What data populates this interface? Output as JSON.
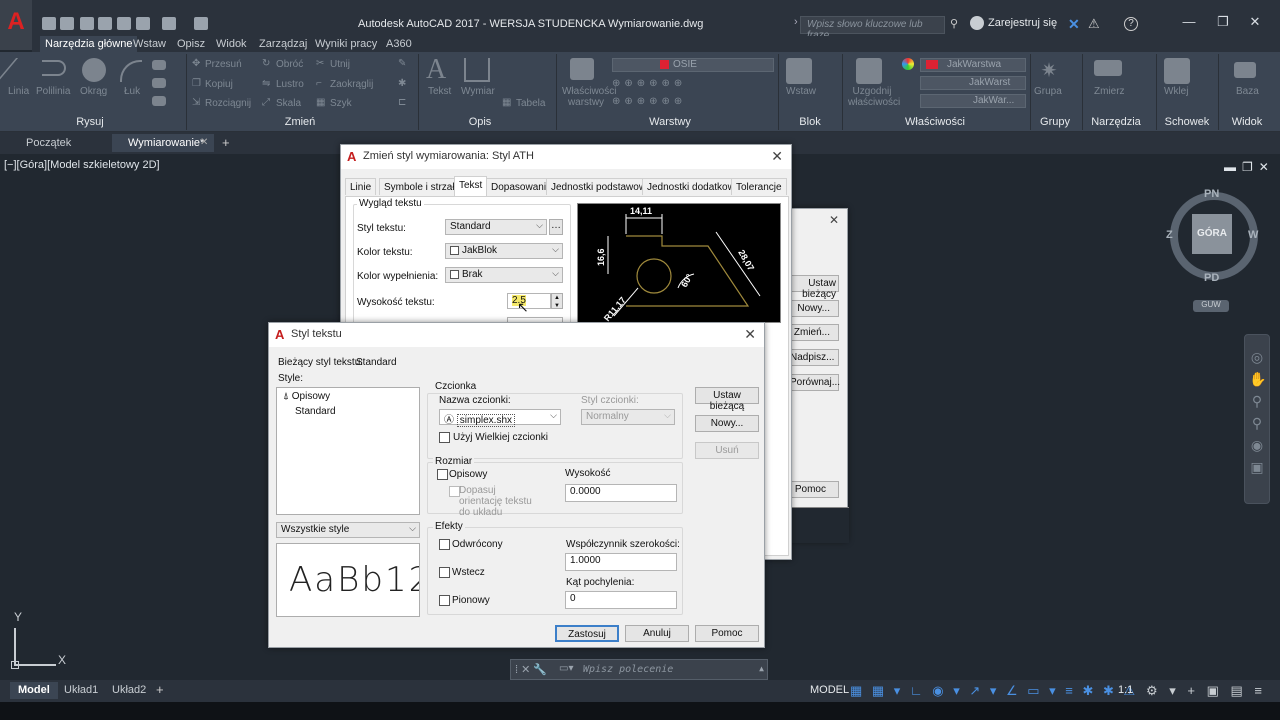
{
  "app": {
    "title": "Autodesk AutoCAD 2017 - WERSJA STUDENCKA    Wymiarowanie.dwg",
    "search_placeholder": "Wpisz słowo kluczowe lub frazę",
    "signin": "Zarejestruj się",
    "help": "?",
    "logo": "A"
  },
  "ribbon_tabs": [
    "Narzędzia główne",
    "Wstaw",
    "Opisz",
    "Widok",
    "Zarządzaj",
    "Wyniki pracy",
    "A360"
  ],
  "ribbon_panels": [
    "Rysuj",
    "Zmień",
    "Opis",
    "Warstwy",
    "Blok",
    "Właściwości",
    "Grupy",
    "Narzędzia",
    "Schowek",
    "Widok"
  ],
  "ribbon_labels": {
    "linia": "Linia",
    "polilinia": "Polilinia",
    "okrag": "Okrąg",
    "luk": "Łuk",
    "przesun": "Przesuń",
    "kopiuj": "Kopiuj",
    "rozciagnij": "Rozciągnij",
    "obroc": "Obróć",
    "lustro": "Lustro",
    "skala": "Skala",
    "utnij": "Utnij",
    "zaokraglij": "Zaokrąglij",
    "szyk": "Szyk",
    "tekst": "Tekst",
    "wymiar": "Wymiar",
    "tabela": "Tabela",
    "wlasciwosci_warstwy": "Właściwości warstwy",
    "layer_name": "OSIE",
    "wstaw": "Wstaw",
    "uzgodnij": "Uzgodnij właściwości",
    "jakwarstwa": "JakWarstwa",
    "jakwarst": "JakWarst",
    "jakwar": "JakWar...",
    "grupa": "Grupa",
    "zmierz": "Zmierz",
    "wklej": "Wklej",
    "baza": "Baza"
  },
  "doc_tabs": [
    "Początek",
    "Wymiarowanie*"
  ],
  "view_label": "[−][Góra][Model szkieletowy 2D]",
  "viewcube": {
    "top": "GÓRA",
    "n": "PN",
    "s": "PD",
    "e": "W",
    "w": "Z",
    "wcs": "GUW"
  },
  "ucs": {
    "x": "X",
    "y": "Y"
  },
  "command_placeholder": "Wpisz polecenie",
  "layout_tabs": [
    "Model",
    "Układ1",
    "Układ2"
  ],
  "status": {
    "model": "MODEL",
    "scale": "1:1"
  },
  "bg_dialog": {
    "buttons": [
      "Ustaw bieżący",
      "Nowy...",
      "Zmień...",
      "Nadpisz...",
      "Porównaj...",
      "Pomoc"
    ]
  },
  "dim_dialog": {
    "title": "Zmień styl wymiarowania: Styl ATH",
    "tabs": [
      "Linie",
      "Symbole i strzałki",
      "Tekst",
      "Dopasowanie",
      "Jednostki podstawowe",
      "Jednostki dodatkowe",
      "Tolerancje"
    ],
    "group": "Wygląd tekstu",
    "rows": [
      {
        "label": "Styl tekstu:",
        "value": "Standard"
      },
      {
        "label": "Kolor tekstu:",
        "value": "JakBlok"
      },
      {
        "label": "Kolor wypełnienia:",
        "value": "Brak"
      }
    ],
    "height_label": "Wysokość tekstu:",
    "height_value": "2.5",
    "preview": {
      "d1": "14,11",
      "d2": "16,6",
      "d3": "28,07",
      "d4": "60°",
      "d5": "R11,17"
    }
  },
  "text_dialog": {
    "title": "Styl tekstu",
    "current_label": "Bieżący styl tekstu:",
    "current_value": "Standard",
    "styles_label": "Style:",
    "styles": [
      "Opisowy",
      "Standard"
    ],
    "filter": "Wszystkie style",
    "preview_text": "AaBb12",
    "font_group": "Czcionka",
    "font_name_label": "Nazwa czcionki:",
    "font_name": "simplex.shx",
    "font_style_label": "Styl czcionki:",
    "font_style": "Normalny",
    "bigfont": "Użyj Wielkiej czcionki",
    "size_group": "Rozmiar",
    "annotative": "Opisowy",
    "match_orientation": "Dopasuj orientację tekstu do układu",
    "height_label": "Wysokość",
    "height_value": "0.0000",
    "effects_group": "Efekty",
    "upside_down": "Odwrócony",
    "backwards": "Wstecz",
    "vertical": "Pionowy",
    "width_label": "Współczynnik szerokości:",
    "width_value": "1.0000",
    "oblique_label": "Kąt pochylenia:",
    "oblique_value": "0",
    "btn_current": "Ustaw bieżącą",
    "btn_new": "Nowy...",
    "btn_delete": "Usuń",
    "btn_apply": "Zastosuj",
    "btn_cancel": "Anuluj",
    "btn_help": "Pomoc"
  },
  "colors": {
    "accent": "#3c7fc9",
    "logo_red": "#c51e1e",
    "canvas": "#212830"
  }
}
